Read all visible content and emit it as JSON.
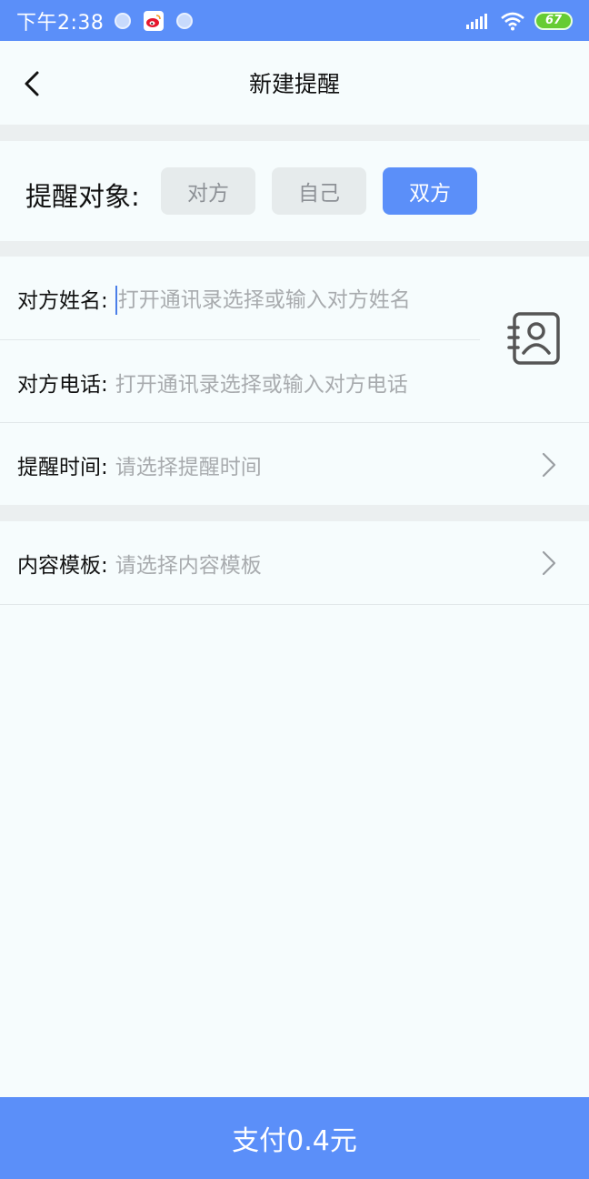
{
  "status_bar": {
    "time": "下午2:38",
    "battery": "67",
    "icons": [
      "notification-dot-icon",
      "weibo-icon",
      "notification-dot-icon",
      "signal-icon",
      "wifi-icon",
      "battery-icon"
    ]
  },
  "header": {
    "title": "新建提醒",
    "back_icon": "chevron-left-icon"
  },
  "target": {
    "label": "提醒对象:",
    "options": [
      {
        "label": "对方",
        "selected": false
      },
      {
        "label": "自己",
        "selected": false
      },
      {
        "label": "双方",
        "selected": true
      }
    ]
  },
  "form": {
    "name": {
      "label": "对方姓名:",
      "placeholder": "打开通讯录选择或输入对方姓名"
    },
    "phone": {
      "label": "对方电话:",
      "placeholder": "打开通讯录选择或输入对方电话"
    },
    "time": {
      "label": "提醒时间:",
      "placeholder": "请选择提醒时间"
    },
    "template": {
      "label": "内容模板:",
      "placeholder": "请选择内容模板"
    },
    "contacts_icon": "address-book-icon"
  },
  "footer": {
    "pay_label": "支付0.4元"
  },
  "colors": {
    "accent": "#5b8ff9",
    "background": "#f6fcfd",
    "separator": "#ebeff0",
    "placeholder": "#a8abae"
  }
}
